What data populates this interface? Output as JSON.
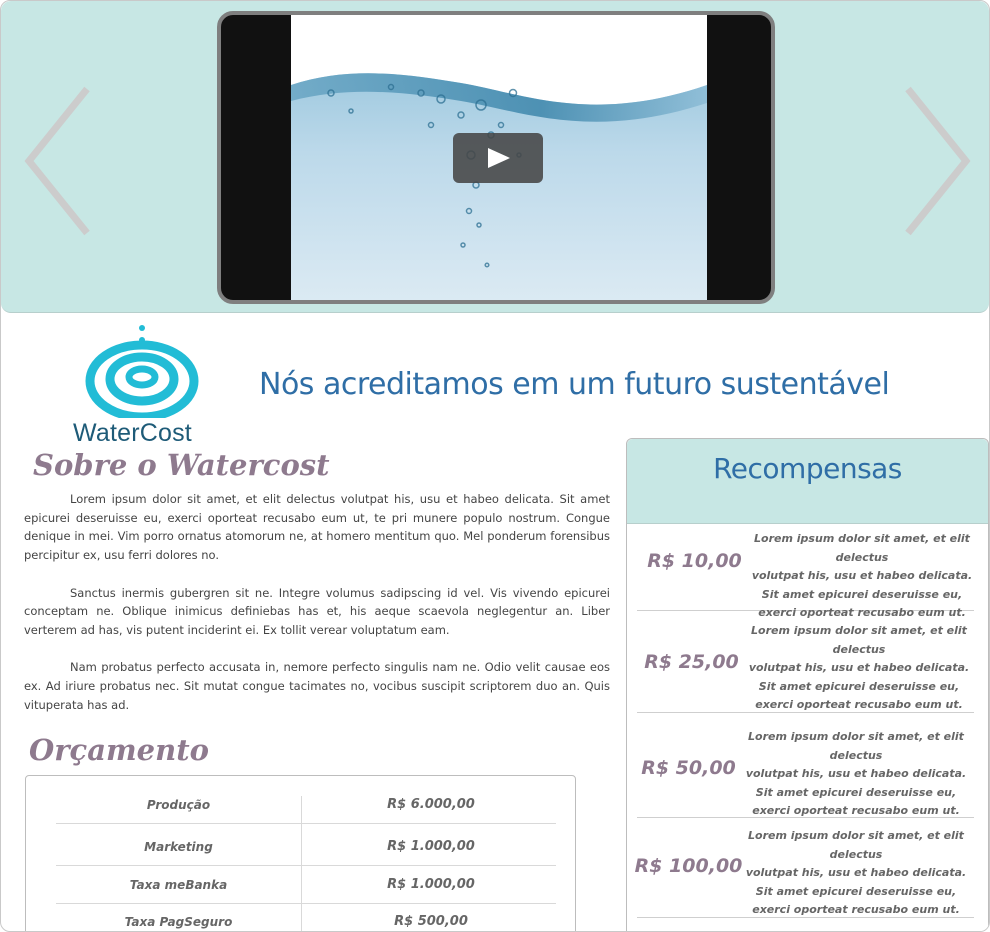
{
  "carousel": {
    "prev_icon": "chevron-left-icon",
    "next_icon": "chevron-right-icon",
    "video": {
      "play_icon": "play-icon"
    },
    "colors": {
      "background": "#c7e7e4",
      "arrow": "#cccccc"
    }
  },
  "brand": {
    "logo_name": "WaterCost",
    "logo_icon": "water-ripple-icon",
    "tagline": "Nós acreditamos em um futuro sustentável",
    "colors": {
      "logo": "#22bcd6",
      "tagline": "#2f6ea6",
      "headings": "#8e7a8e"
    }
  },
  "about": {
    "title": "Sobre o Watercost",
    "paragraphs": [
      "Lorem ipsum dolor sit amet, et elit delectus volutpat his, usu et habeo delicata. Sit amet epicurei deseruisse eu, exerci oporteat recusabo eum ut, te pri munere populo nostrum. Congue denique in mei. Vim porro ornatus atomorum ne, at homero mentitum quo. Mel ponderum forensibus percipitur ex, usu ferri dolores no.",
      "Sanctus inermis gubergren sit ne. Integre volumus sadipscing id vel. Vis vivendo epicurei conceptam ne. Oblique inimicus definiebas has et, his aeque scaevola neglegentur an. Liber verterem ad has, vis putent inciderint ei. Ex tollit verear voluptatum eam.",
      "Nam probatus perfecto accusata in, nemore perfecto singulis nam ne. Odio velit causae eos ex. Ad iriure probatus nec. Sit mutat congue tacimates no, vocibus suscipit scriptorem duo an. Quis vituperata has ad."
    ]
  },
  "budget": {
    "title": "Orçamento",
    "rows": [
      {
        "label": "Produção",
        "value": "R$ 6.000,00"
      },
      {
        "label": "Marketing",
        "value": "R$ 1.000,00"
      },
      {
        "label": "Taxa meBanka",
        "value": "R$ 1.000,00"
      },
      {
        "label": "Taxa PagSeguro",
        "value": "R$ 500,00"
      }
    ]
  },
  "rewards": {
    "title": "Recompensas",
    "items": [
      {
        "price": "R$ 10,00",
        "lines": [
          "Lorem ipsum dolor sit amet, et elit delectus",
          "volutpat his, usu et habeo delicata.",
          "Sit amet epicurei deseruisse eu,",
          "exerci oporteat recusabo eum ut."
        ]
      },
      {
        "price": "R$ 25,00",
        "lines": [
          "Lorem ipsum dolor sit amet, et elit delectus",
          "volutpat his, usu et habeo delicata.",
          "Sit amet epicurei deseruisse eu,",
          "exerci oporteat recusabo eum ut."
        ]
      },
      {
        "price": "R$ 50,00",
        "lines": [
          "Lorem ipsum dolor sit amet, et elit delectus",
          "volutpat his, usu et habeo delicata.",
          "Sit amet epicurei deseruisse eu,",
          "exerci oporteat recusabo eum ut."
        ]
      },
      {
        "price": "R$ 100,00",
        "lines": [
          "Lorem ipsum dolor sit amet, et elit delectus",
          "volutpat his, usu et habeo delicata.",
          "Sit amet epicurei deseruisse eu,",
          "exerci oporteat recusabo eum ut."
        ]
      }
    ]
  }
}
